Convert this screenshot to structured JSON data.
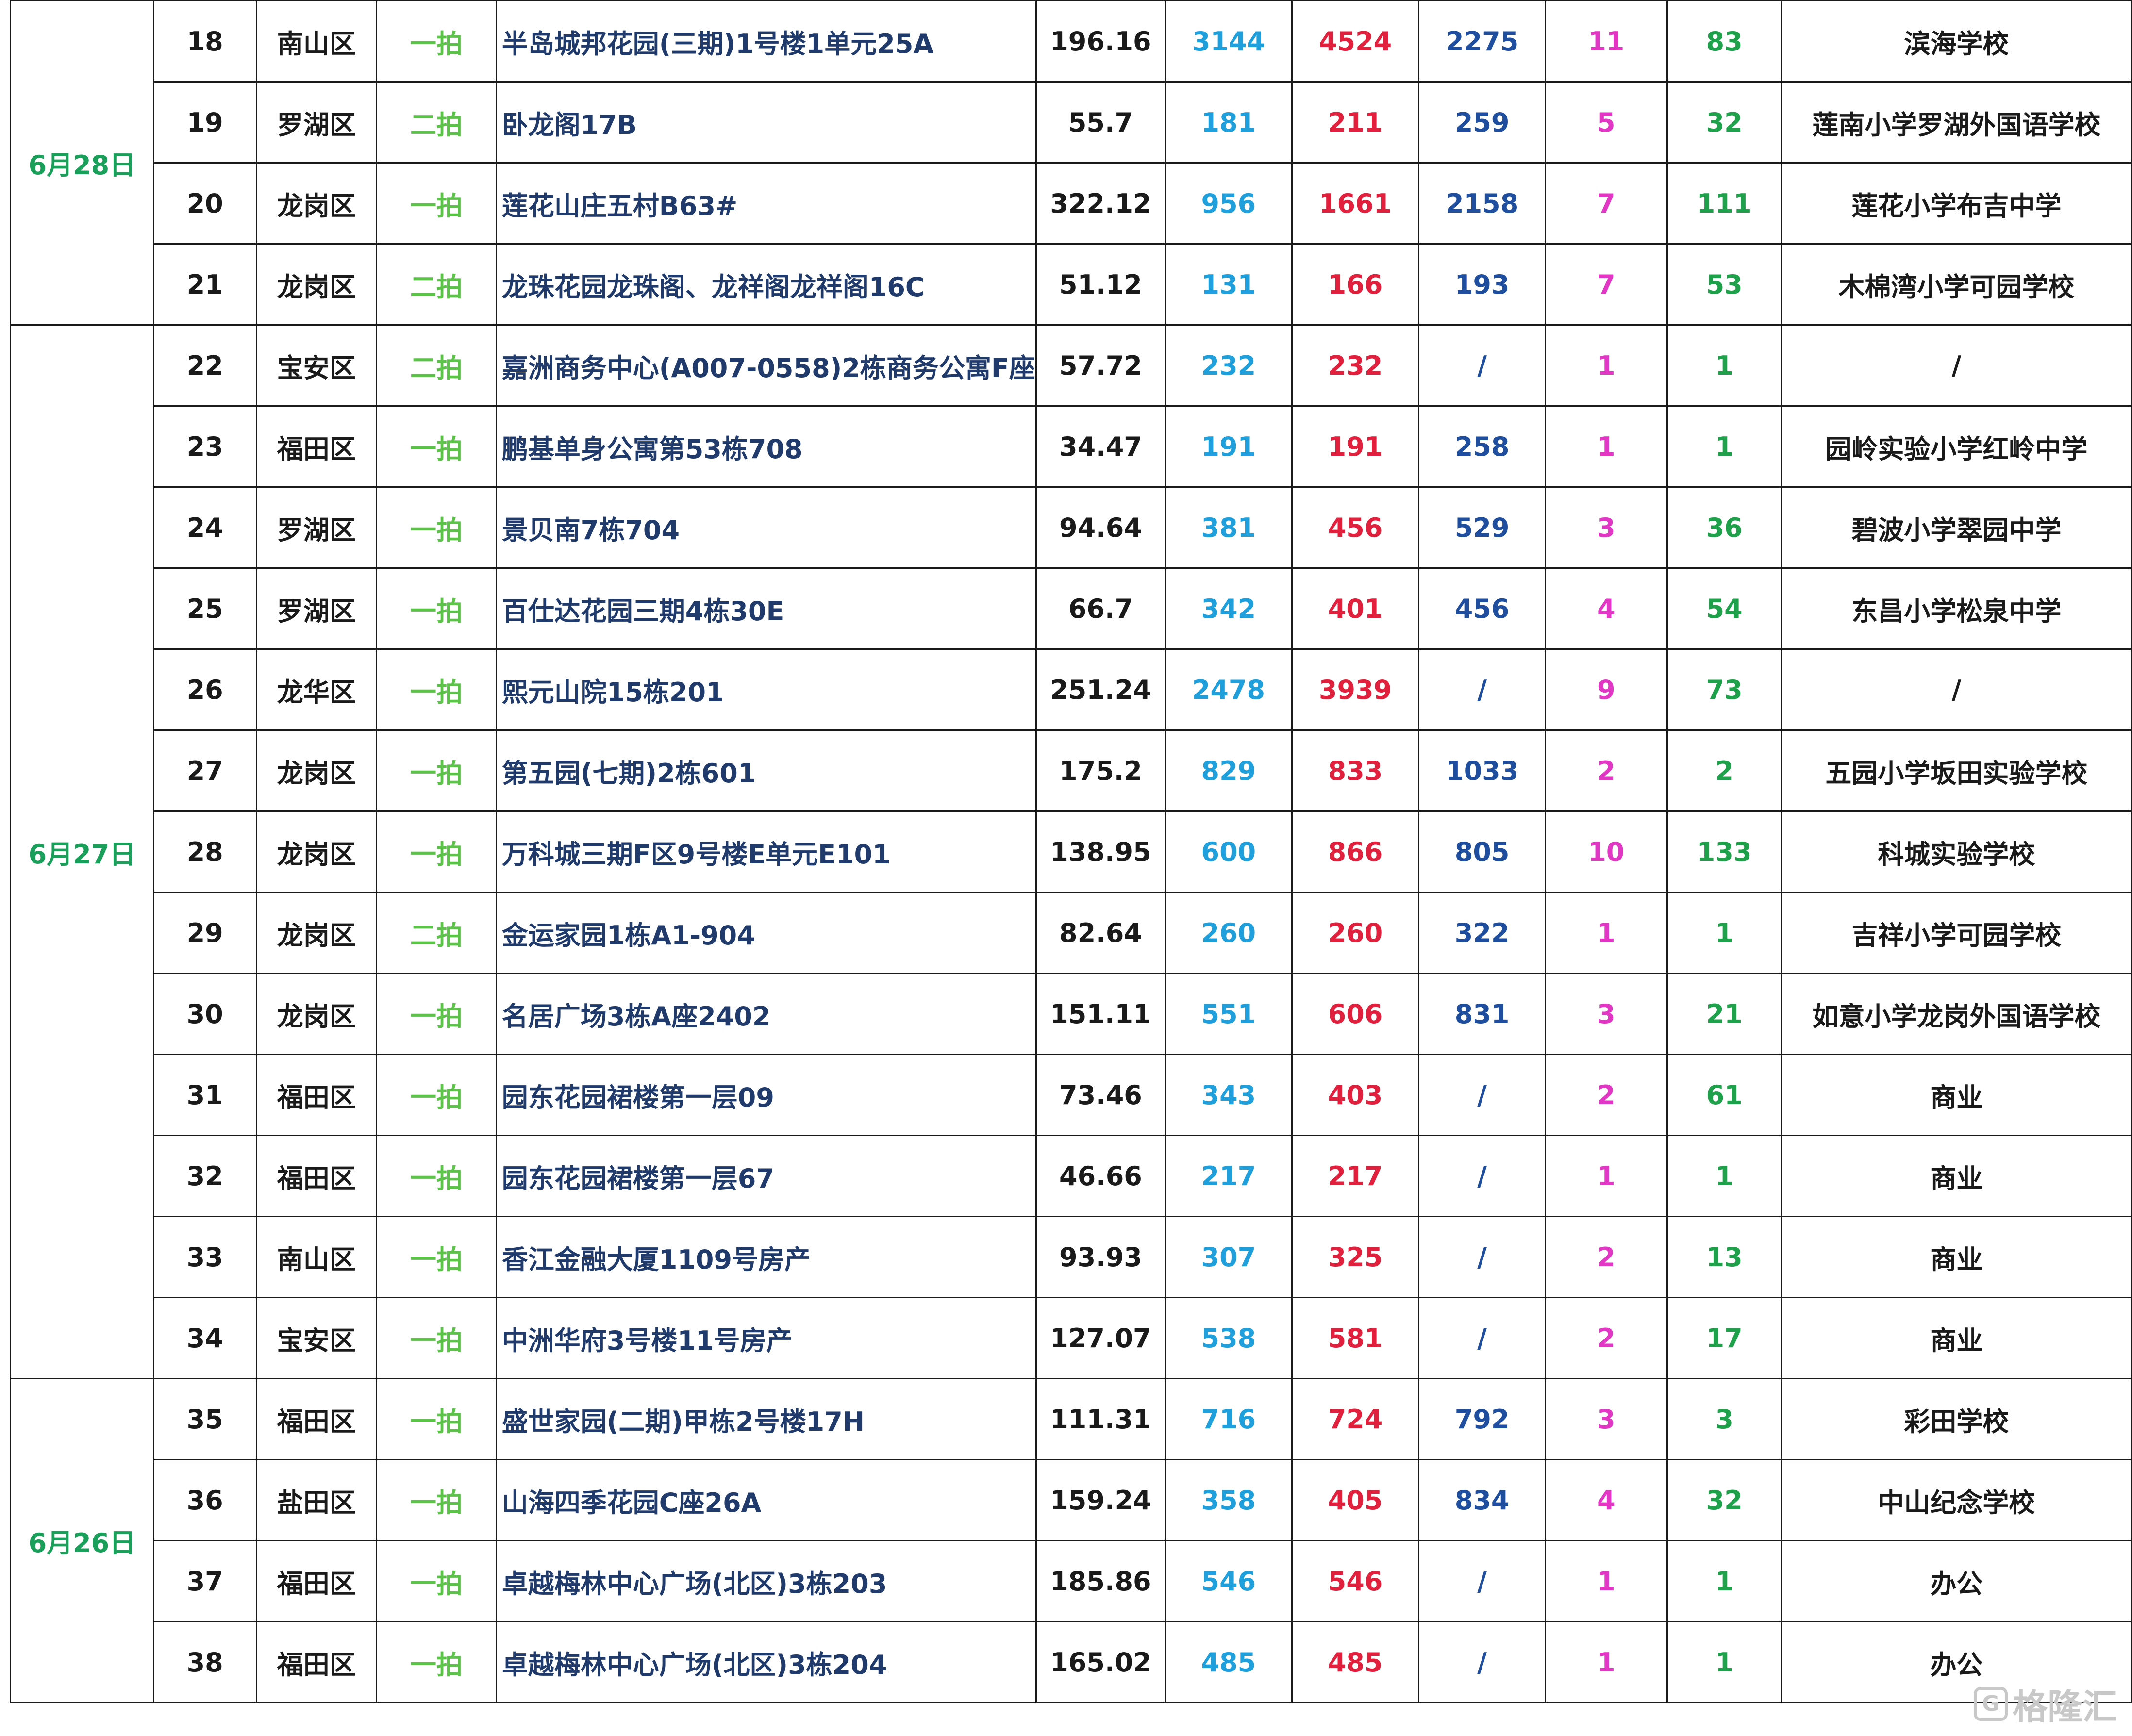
{
  "groups": [
    {
      "date": "6月28日",
      "rows": [
        {
          "no": "18",
          "district": "南山区",
          "round": "一拍",
          "name": "半岛城邦花园(三期)1号楼1单元25A",
          "area": "196.16",
          "p1": "3144",
          "p2": "4524",
          "p3": "2275",
          "c1": "11",
          "c2": "83",
          "school": "滨海学校"
        },
        {
          "no": "19",
          "district": "罗湖区",
          "round": "二拍",
          "name": "卧龙阁17B",
          "area": "55.7",
          "p1": "181",
          "p2": "211",
          "p3": "259",
          "c1": "5",
          "c2": "32",
          "school": "莲南小学罗湖外国语学校"
        },
        {
          "no": "20",
          "district": "龙岗区",
          "round": "一拍",
          "name": "莲花山庄五村B63#",
          "area": "322.12",
          "p1": "956",
          "p2": "1661",
          "p3": "2158",
          "c1": "7",
          "c2": "111",
          "school": "莲花小学布吉中学"
        },
        {
          "no": "21",
          "district": "龙岗区",
          "round": "二拍",
          "name": "龙珠花园龙珠阁、龙祥阁龙祥阁16C",
          "area": "51.12",
          "p1": "131",
          "p2": "166",
          "p3": "193",
          "c1": "7",
          "c2": "53",
          "school": "木棉湾小学可园学校"
        }
      ]
    },
    {
      "date": "6月27日",
      "rows": [
        {
          "no": "22",
          "district": "宝安区",
          "round": "二拍",
          "name": "嘉洲商务中心(A007-0558)2栋商务公寓F座",
          "area": "57.72",
          "p1": "232",
          "p2": "232",
          "p3": "/",
          "c1": "1",
          "c2": "1",
          "school": "/"
        },
        {
          "no": "23",
          "district": "福田区",
          "round": "一拍",
          "name": "鹏基单身公寓第53栋708",
          "area": "34.47",
          "p1": "191",
          "p2": "191",
          "p3": "258",
          "c1": "1",
          "c2": "1",
          "school": "园岭实验小学红岭中学"
        },
        {
          "no": "24",
          "district": "罗湖区",
          "round": "一拍",
          "name": "景贝南7栋704",
          "area": "94.64",
          "p1": "381",
          "p2": "456",
          "p3": "529",
          "c1": "3",
          "c2": "36",
          "school": "碧波小学翠园中学"
        },
        {
          "no": "25",
          "district": "罗湖区",
          "round": "一拍",
          "name": "百仕达花园三期4栋30E",
          "area": "66.7",
          "p1": "342",
          "p2": "401",
          "p3": "456",
          "c1": "4",
          "c2": "54",
          "school": "东昌小学松泉中学"
        },
        {
          "no": "26",
          "district": "龙华区",
          "round": "一拍",
          "name": "熙元山院15栋201",
          "area": "251.24",
          "p1": "2478",
          "p2": "3939",
          "p3": "/",
          "c1": "9",
          "c2": "73",
          "school": "/"
        },
        {
          "no": "27",
          "district": "龙岗区",
          "round": "一拍",
          "name": "第五园(七期)2栋601",
          "area": "175.2",
          "p1": "829",
          "p2": "833",
          "p3": "1033",
          "c1": "2",
          "c2": "2",
          "school": "五园小学坂田实验学校"
        },
        {
          "no": "28",
          "district": "龙岗区",
          "round": "一拍",
          "name": "万科城三期F区9号楼E单元E101",
          "area": "138.95",
          "p1": "600",
          "p2": "866",
          "p3": "805",
          "c1": "10",
          "c2": "133",
          "school": "科城实验学校"
        },
        {
          "no": "29",
          "district": "龙岗区",
          "round": "二拍",
          "name": "金运家园1栋A1-904",
          "area": "82.64",
          "p1": "260",
          "p2": "260",
          "p3": "322",
          "c1": "1",
          "c2": "1",
          "school": "吉祥小学可园学校"
        },
        {
          "no": "30",
          "district": "龙岗区",
          "round": "一拍",
          "name": "名居广场3栋A座2402",
          "area": "151.11",
          "p1": "551",
          "p2": "606",
          "p3": "831",
          "c1": "3",
          "c2": "21",
          "school": "如意小学龙岗外国语学校"
        },
        {
          "no": "31",
          "district": "福田区",
          "round": "一拍",
          "name": "园东花园裙楼第一层09",
          "area": "73.46",
          "p1": "343",
          "p2": "403",
          "p3": "/",
          "c1": "2",
          "c2": "61",
          "school": "商业"
        },
        {
          "no": "32",
          "district": "福田区",
          "round": "一拍",
          "name": "园东花园裙楼第一层67",
          "area": "46.66",
          "p1": "217",
          "p2": "217",
          "p3": "/",
          "c1": "1",
          "c2": "1",
          "school": "商业"
        },
        {
          "no": "33",
          "district": "南山区",
          "round": "一拍",
          "name": "香江金融大厦1109号房产",
          "area": "93.93",
          "p1": "307",
          "p2": "325",
          "p3": "/",
          "c1": "2",
          "c2": "13",
          "school": "商业"
        },
        {
          "no": "34",
          "district": "宝安区",
          "round": "一拍",
          "name": "中洲华府3号楼11号房产",
          "area": "127.07",
          "p1": "538",
          "p2": "581",
          "p3": "/",
          "c1": "2",
          "c2": "17",
          "school": "商业"
        }
      ]
    },
    {
      "date": "6月26日",
      "rows": [
        {
          "no": "35",
          "district": "福田区",
          "round": "一拍",
          "name": "盛世家园(二期)甲栋2号楼17H",
          "area": "111.31",
          "p1": "716",
          "p2": "724",
          "p3": "792",
          "c1": "3",
          "c2": "3",
          "school": "彩田学校"
        },
        {
          "no": "36",
          "district": "盐田区",
          "round": "一拍",
          "name": "山海四季花园C座26A",
          "area": "159.24",
          "p1": "358",
          "p2": "405",
          "p3": "834",
          "c1": "4",
          "c2": "32",
          "school": "中山纪念学校"
        },
        {
          "no": "37",
          "district": "福田区",
          "round": "一拍",
          "name": "卓越梅林中心广场(北区)3栋203",
          "area": "185.86",
          "p1": "546",
          "p2": "546",
          "p3": "/",
          "c1": "1",
          "c2": "1",
          "school": "办公"
        },
        {
          "no": "38",
          "district": "福田区",
          "round": "一拍",
          "name": "卓越梅林中心广场(北区)3栋204",
          "area": "165.02",
          "p1": "485",
          "p2": "485",
          "p3": "/",
          "c1": "1",
          "c2": "1",
          "school": "办公"
        }
      ]
    }
  ],
  "watermark": {
    "text": "格隆汇",
    "logo": "G"
  }
}
